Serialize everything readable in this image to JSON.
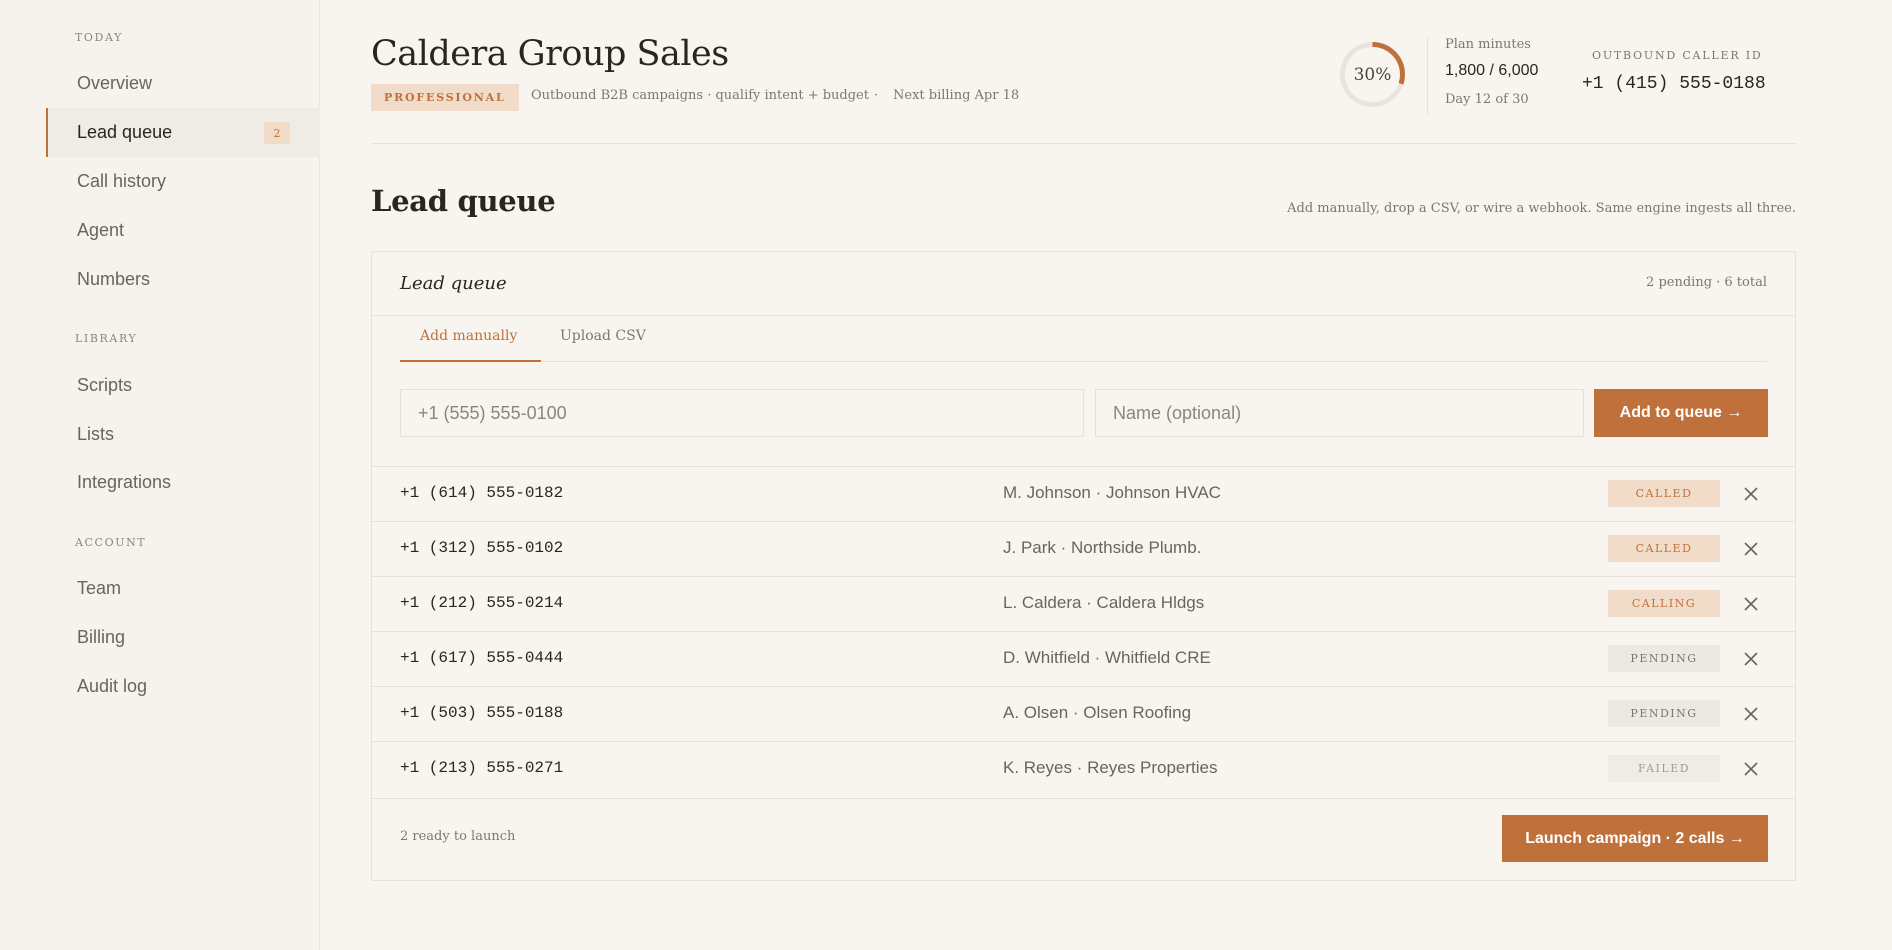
{
  "sidebar": {
    "sections": [
      {
        "title": "TODAY",
        "items": [
          {
            "label": "Overview",
            "active": false
          },
          {
            "label": "Lead queue",
            "active": true,
            "badge": "2"
          },
          {
            "label": "Call history",
            "active": false
          },
          {
            "label": "Agent",
            "active": false
          },
          {
            "label": "Numbers",
            "active": false
          }
        ]
      },
      {
        "title": "LIBRARY",
        "items": [
          {
            "label": "Scripts"
          },
          {
            "label": "Lists"
          },
          {
            "label": "Integrations"
          }
        ]
      },
      {
        "title": "ACCOUNT",
        "items": [
          {
            "label": "Team"
          },
          {
            "label": "Billing"
          },
          {
            "label": "Audit log"
          }
        ]
      }
    ]
  },
  "header": {
    "org_name": "Caldera Group Sales",
    "plan_badge": "PROFESSIONAL",
    "campaign_desc": "Outbound B2B campaigns · qualify intent + budget",
    "dot_sep": "·",
    "next_billing": "Next billing Apr 18",
    "usage": {
      "percent_label": "30%",
      "fraction": 0.3,
      "plan_minutes_label": "Plan minutes",
      "plan_minutes_value": "1,800 / 6,000",
      "day_label": "Day 12 of 30"
    },
    "caller_id": {
      "label": "OUTBOUND CALLER ID",
      "value": "+1 (415) 555-0188"
    }
  },
  "page": {
    "title": "Lead queue",
    "hint": "Add manually, drop a CSV, or wire a webhook. Same engine ingests all three."
  },
  "queue_card": {
    "title": "Lead queue",
    "count": "2 pending · 6 total",
    "tabs": [
      {
        "label": "Add manually",
        "active": true
      },
      {
        "label": "Upload CSV",
        "active": false
      }
    ],
    "phone_placeholder": "+1 (555) 555-0100",
    "name_placeholder": "Name (optional)",
    "add_button": "Add to queue →",
    "leads": [
      {
        "phone": "+1 (614) 555-0182",
        "name": "M. Johnson · Johnson HVAC",
        "status": "CALLED",
        "kind": "called"
      },
      {
        "phone": "+1 (312) 555-0102",
        "name": "J. Park · Northside Plumb.",
        "status": "CALLED",
        "kind": "called"
      },
      {
        "phone": "+1 (212) 555-0214",
        "name": "L. Caldera · Caldera Hldgs",
        "status": "CALLING",
        "kind": "calling"
      },
      {
        "phone": "+1 (617) 555-0444",
        "name": "D. Whitfield · Whitfield CRE",
        "status": "PENDING",
        "kind": "pending"
      },
      {
        "phone": "+1 (503) 555-0188",
        "name": "A. Olsen · Olsen Roofing",
        "status": "PENDING",
        "kind": "pending"
      },
      {
        "phone": "+1 (213) 555-0271",
        "name": "K. Reyes · Reyes Properties",
        "status": "FAILED",
        "kind": "failed"
      }
    ],
    "footer_text": "2 ready to launch",
    "launch_button": "Launch campaign · 2 calls →"
  },
  "colors": {
    "accent": "#c0703a",
    "badge_bg": "#f1dcc9",
    "background": "#f8f5f0",
    "text": "#2a2520"
  },
  "icons": {
    "remove": "close-icon"
  }
}
